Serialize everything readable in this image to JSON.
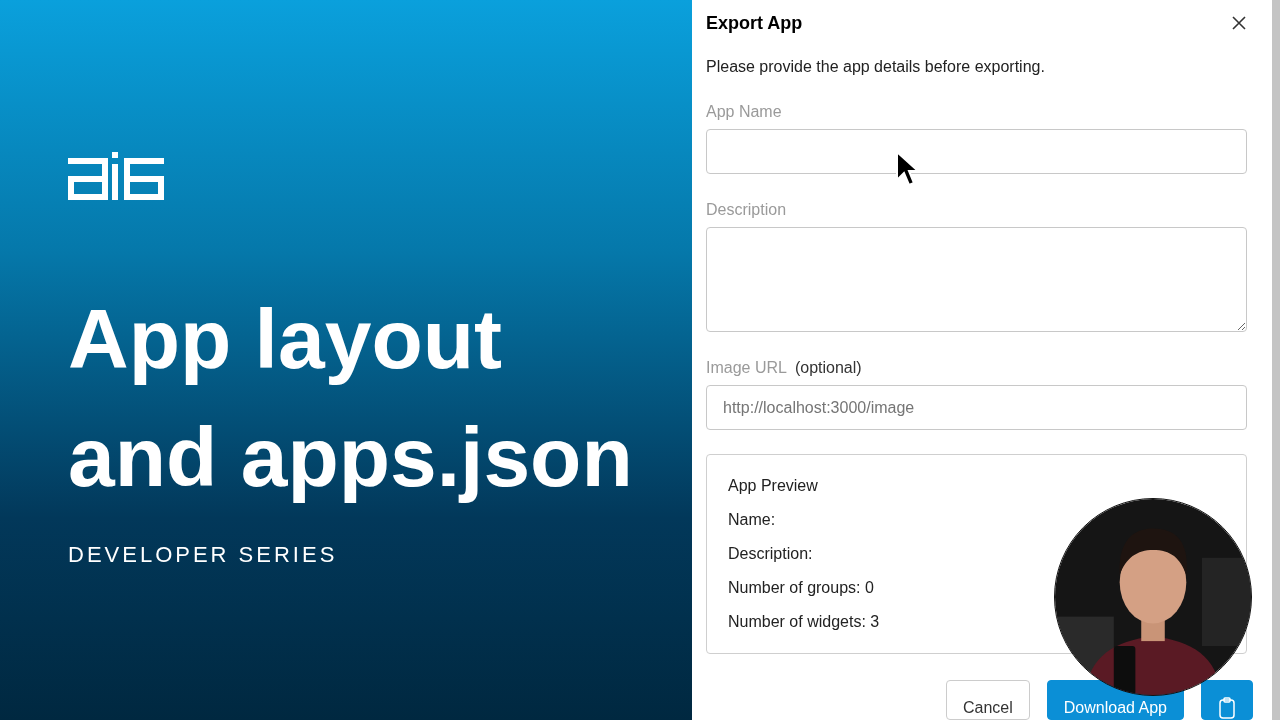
{
  "title_card": {
    "title": "App layout and apps.json",
    "subtitle": "DEVELOPER SERIES"
  },
  "dialog": {
    "title": "Export App",
    "intro": "Please provide the app details before exporting.",
    "fields": [
      {
        "kind": "input",
        "label": "App Name"
      },
      {
        "kind": "textarea",
        "label": "Description"
      },
      {
        "kind": "input",
        "label": "Image URL",
        "note": "(optional)",
        "placeholder": "http://localhost:3000/image"
      }
    ],
    "preview": {
      "title": "App Preview",
      "lines": [
        "Name:",
        "Description:",
        "Number of groups: 0",
        "Number of widgets: 3"
      ]
    },
    "buttons": [
      {
        "kind": "secondary",
        "label": "Cancel"
      },
      {
        "kind": "primary",
        "label": "Download App"
      },
      {
        "kind": "icon"
      }
    ]
  }
}
